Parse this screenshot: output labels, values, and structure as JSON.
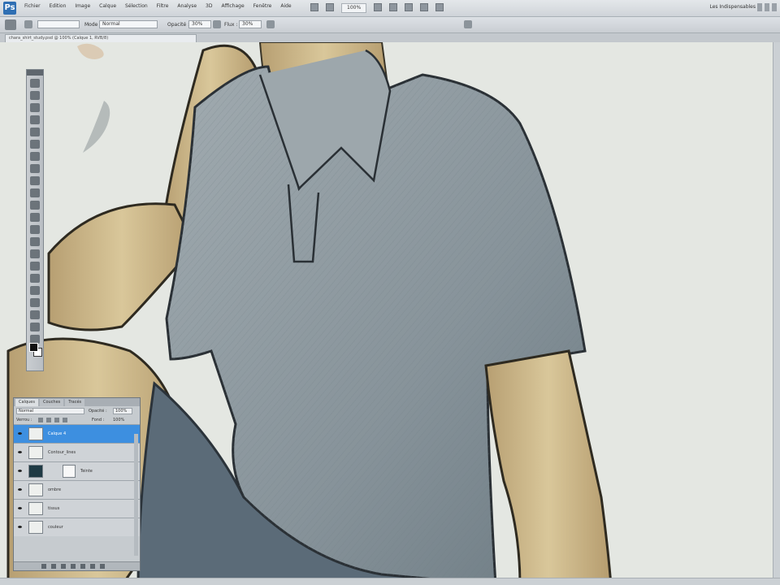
{
  "menubar": {
    "logo": "Ps",
    "menus": [
      "Fichier",
      "Edition",
      "Image",
      "Calque",
      "Sélection",
      "Filtre",
      "Analyse",
      "3D",
      "Affichage",
      "Fenêtre",
      "Aide"
    ],
    "zoom": "100%",
    "workspace": "Les Indispensables"
  },
  "options": {
    "mode_label": "Mode :",
    "mode_value": "Normal",
    "opacity_label": "Opacité :",
    "opacity_value": "30%",
    "flow_label": "Flux :",
    "flow_value": "30%"
  },
  "document": {
    "tab_title": "chara_shirt_study.psd @ 100% (Calque 1, RVB/8)"
  },
  "tools": [
    "move",
    "marquee",
    "lasso",
    "quick-select",
    "crop",
    "eyedropper",
    "healing",
    "brush",
    "stamp",
    "history-brush",
    "eraser",
    "gradient",
    "blur",
    "dodge",
    "pen",
    "type",
    "path-select",
    "shape",
    "hand",
    "zoom",
    "3d-rotate",
    "3d-orbit",
    "foreground-background"
  ],
  "layers_panel": {
    "tabs": [
      "Calques",
      "Couches",
      "Tracés"
    ],
    "blend_mode": "Normal",
    "opacity_label": "Opacité :",
    "opacity_value": "100%",
    "lock_label": "Verrou :",
    "fill_label": "Fond :",
    "fill_value": "100%",
    "layers": [
      {
        "name": "Calque 4",
        "selected": true
      },
      {
        "name": "Contour_lines",
        "selected": false
      },
      {
        "name": "Teinte",
        "selected": false,
        "mask": true
      },
      {
        "name": "ombre",
        "selected": false
      },
      {
        "name": "tissus",
        "selected": false
      },
      {
        "name": "couleur",
        "selected": false
      }
    ]
  },
  "colors": {
    "canvas_bg": "#e4e7e2",
    "shirt": "#8f9ba1",
    "skin": "#cdb98a",
    "pants": "#5b6b78",
    "selected_layer": "#3d8fe0"
  }
}
